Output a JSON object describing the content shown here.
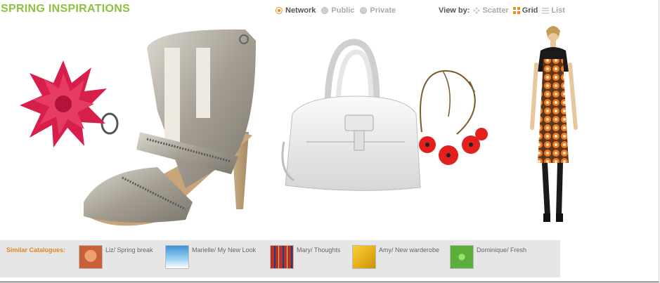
{
  "header": {
    "title": "SPRING INSPIRATIONS"
  },
  "visibility": [
    {
      "label": "Network",
      "state": "selected"
    },
    {
      "label": "Public",
      "state": "disabled"
    },
    {
      "label": "Private",
      "state": "disabled"
    }
  ],
  "view_by": {
    "label": "View by:",
    "options": [
      {
        "label": "Scatter",
        "icon": "scatter-icon"
      },
      {
        "label": "Grid",
        "icon": "grid-icon",
        "active": true
      },
      {
        "label": "List",
        "icon": "list-icon"
      }
    ]
  },
  "products": [
    {
      "name": "red flower ring",
      "icon": "flower-ring-image"
    },
    {
      "name": "silver zipper heel sandal",
      "icon": "sandal-image"
    },
    {
      "name": "white leather handbag",
      "icon": "handbag-image"
    },
    {
      "name": "red flower necklace",
      "icon": "necklace-image"
    },
    {
      "name": "orange patterned dress model",
      "icon": "model-image"
    }
  ],
  "similar": {
    "label": "Similar Catalogues:",
    "items": [
      {
        "name": "Liz/ Spring break",
        "thumb_color": "#c8603a"
      },
      {
        "name": "Marielle/ My New Look",
        "thumb_color": "#6eb8ea"
      },
      {
        "name": "Mary/ Thoughts",
        "thumb_color": "#b8322c"
      },
      {
        "name": "Amy/ New warderobe",
        "thumb_color": "#e8b21c"
      },
      {
        "name": "Dominique/ Fresh",
        "thumb_color": "#5aae3a"
      }
    ]
  }
}
